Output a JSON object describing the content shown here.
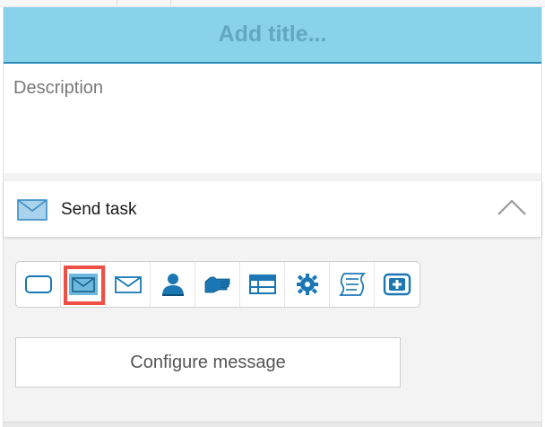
{
  "panel": {
    "title_placeholder": "Add title...",
    "description_placeholder": "Description"
  },
  "section": {
    "label": "Send task",
    "icon": "envelope-icon",
    "toggle_icon": "chevron-up-icon"
  },
  "task_types": [
    {
      "name": "empty-task-icon",
      "selected": false
    },
    {
      "name": "send-task-icon",
      "selected": true
    },
    {
      "name": "receive-task-icon",
      "selected": false
    },
    {
      "name": "user-task-icon",
      "selected": false
    },
    {
      "name": "manual-task-icon",
      "selected": false
    },
    {
      "name": "business-rule-task-icon",
      "selected": false
    },
    {
      "name": "service-task-icon",
      "selected": false
    },
    {
      "name": "script-task-icon",
      "selected": false
    },
    {
      "name": "call-activity-icon",
      "selected": false
    }
  ],
  "configure_button_label": "Configure message",
  "colors": {
    "title_bar": "#89d3ea",
    "title_text": "#5fa8c0",
    "accent": "#2c8ab8",
    "selection_highlight": "#ef4f45",
    "icon_fill": "#1b77b3"
  }
}
